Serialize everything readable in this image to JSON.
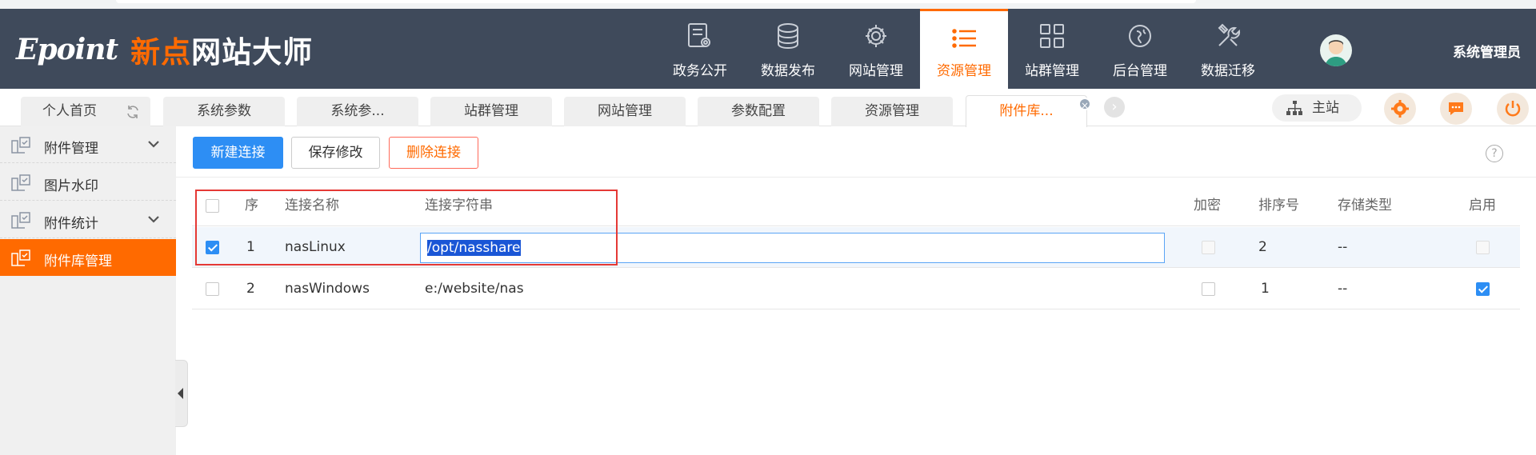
{
  "header": {
    "logo_mark": "Epoint",
    "logo_cn_orange": "新点",
    "logo_cn_white": "网站大师",
    "nav": [
      {
        "label": "政务公开",
        "icon": "document-eye-icon"
      },
      {
        "label": "数据发布",
        "icon": "database-icon"
      },
      {
        "label": "网站管理",
        "icon": "gear-icon"
      },
      {
        "label": "资源管理",
        "icon": "list-icon",
        "active": true
      },
      {
        "label": "站群管理",
        "icon": "grid-icon"
      },
      {
        "label": "后台管理",
        "icon": "compass-icon"
      },
      {
        "label": "数据迁移",
        "icon": "tools-icon"
      }
    ],
    "username": "系统管理员"
  },
  "tabs": [
    {
      "label": "个人首页"
    },
    {
      "label": "系统参数"
    },
    {
      "label": "系统参..."
    },
    {
      "label": "站群管理"
    },
    {
      "label": "网站管理"
    },
    {
      "label": "参数配置"
    },
    {
      "label": "资源管理"
    },
    {
      "label": "附件库...",
      "active": true
    }
  ],
  "home_button": "主站",
  "sidebar": {
    "items": [
      {
        "label": "附件管理",
        "expandable": true
      },
      {
        "label": "图片水印"
      },
      {
        "label": "附件统计",
        "expandable": true
      },
      {
        "label": "附件库管理",
        "active": true
      }
    ]
  },
  "toolbar": {
    "new_label": "新建连接",
    "save_label": "保存修改",
    "delete_label": "删除连接",
    "help": "?"
  },
  "table": {
    "headers": {
      "seq": "序",
      "name": "连接名称",
      "conn": "连接字符串",
      "encrypt": "加密",
      "order": "排序号",
      "storage": "存储类型",
      "enabled": "启用"
    },
    "rows": [
      {
        "seq": "1",
        "name": "nasLinux",
        "conn": "/opt/nasshare",
        "order": "2",
        "storage": "--",
        "selected": true,
        "editing": true,
        "encrypt": false,
        "enabled": false
      },
      {
        "seq": "2",
        "name": "nasWindows",
        "conn": "e:/website/nas",
        "order": "1",
        "storage": "--",
        "selected": false,
        "encrypt": false,
        "enabled": true
      }
    ]
  },
  "colors": {
    "header_bg": "#3f4a5b",
    "accent": "#ff6a00",
    "primary": "#2d8ef4"
  }
}
